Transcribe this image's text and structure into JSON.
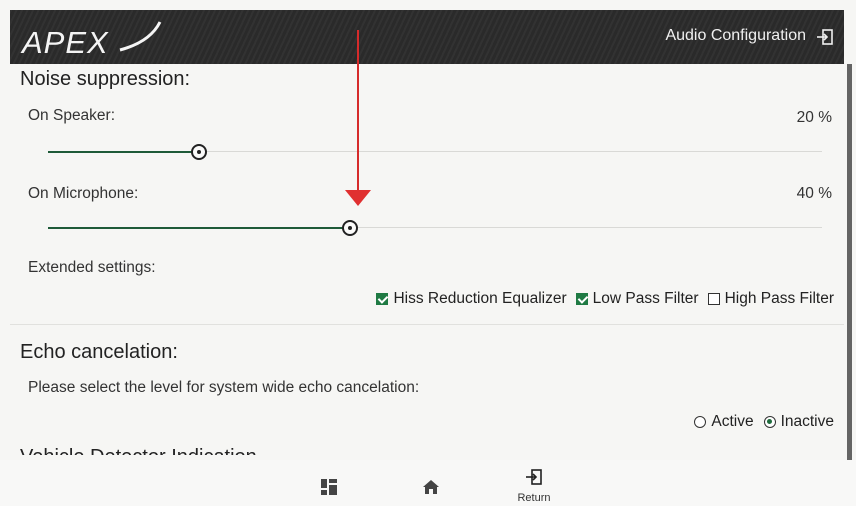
{
  "header": {
    "logo_text": "APEX",
    "title": "Audio Configuration",
    "logout_icon": "logout-icon"
  },
  "noise": {
    "title": "Noise suppression:",
    "speaker": {
      "label": "On Speaker:",
      "value_text": "20 %",
      "value": 20
    },
    "microphone": {
      "label": "On Microphone:",
      "value_text": "40 %",
      "value": 40
    },
    "extended_label": "Extended settings:",
    "checks": [
      {
        "label": "Hiss Reduction Equalizer",
        "checked": true
      },
      {
        "label": "Low Pass Filter",
        "checked": true
      },
      {
        "label": "High Pass Filter",
        "checked": false
      }
    ]
  },
  "echo": {
    "title": "Echo cancelation:",
    "prompt": "Please select the level for system wide echo cancelation:",
    "options": [
      {
        "label": "Active",
        "selected": false
      },
      {
        "label": "Inactive",
        "selected": true
      }
    ]
  },
  "partial_section_title": "Vehicle Detector Indication",
  "nav": {
    "dashboard_icon": "grid-icon",
    "home_icon": "home-icon",
    "return_label": "Return"
  },
  "colors": {
    "header_bg": "#2a2a2a",
    "slider_fill": "#1e5a38",
    "checkbox_on": "#1f7a43",
    "annotation_arrow": "#e03030"
  }
}
